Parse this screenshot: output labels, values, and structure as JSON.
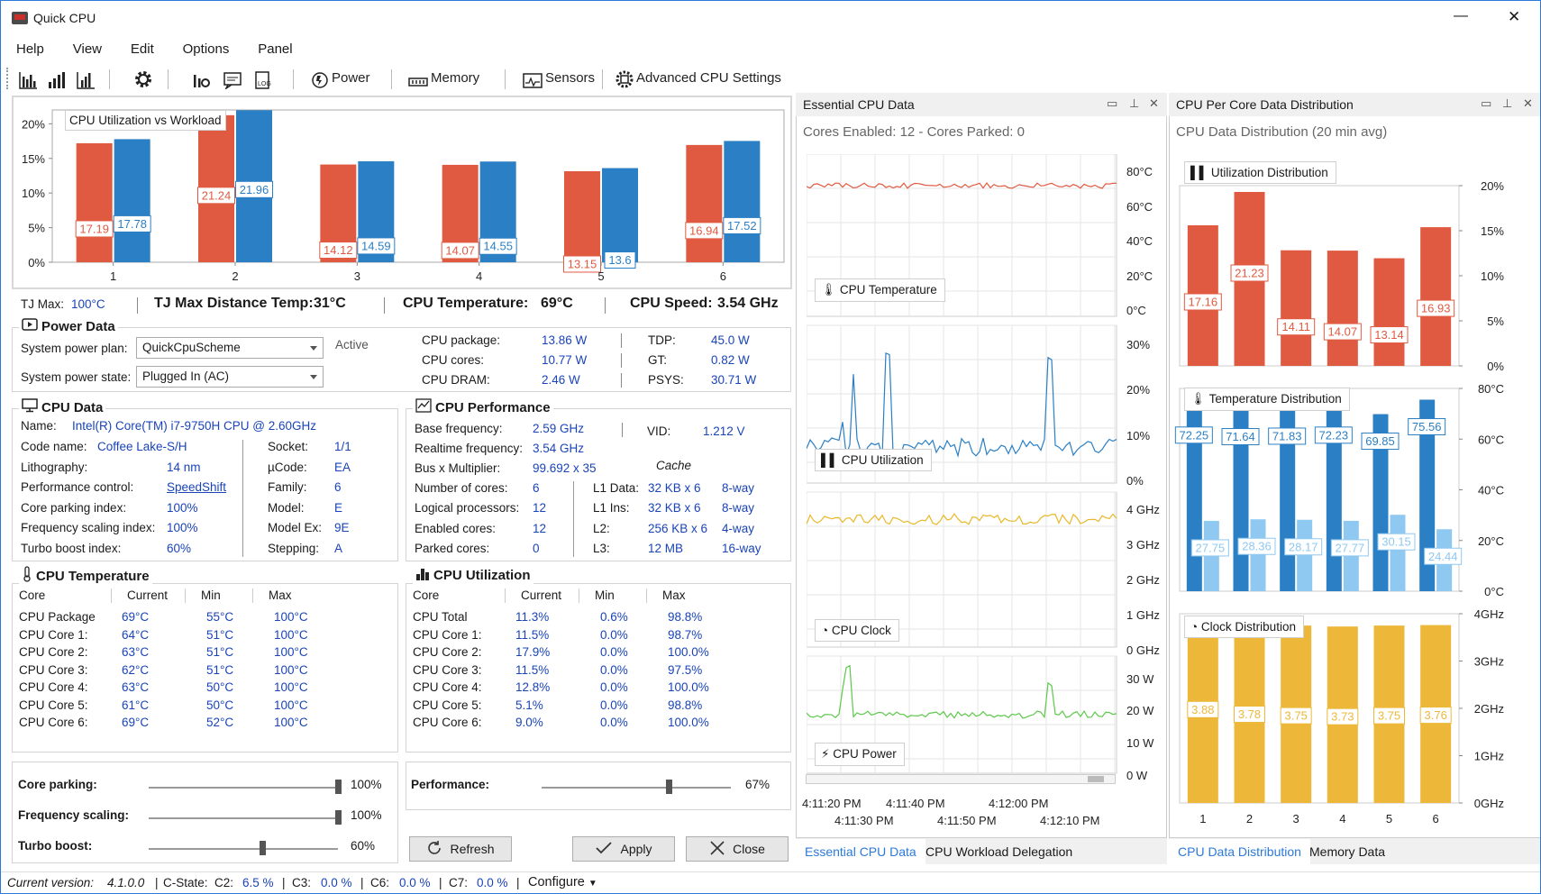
{
  "window": {
    "title": "Quick CPU",
    "minimize": "—",
    "close": "✕"
  },
  "menu": [
    "Help",
    "View",
    "Edit",
    "Options",
    "Panel"
  ],
  "toolbar": {
    "power": "Power",
    "memory": "Memory",
    "sensors": "Sensors",
    "advanced": "Advanced CPU Settings"
  },
  "main_chart": {
    "title": "CPU Utilization vs Workload",
    "chart_data": {
      "type": "bar",
      "categories": [
        "1",
        "2",
        "3",
        "4",
        "5",
        "6"
      ],
      "series": [
        {
          "values": [
            17.19,
            21.24,
            14.12,
            14.07,
            13.15,
            16.94
          ],
          "color": "#e05a41"
        },
        {
          "values": [
            17.78,
            21.96,
            14.59,
            14.55,
            13.6,
            17.52
          ],
          "color": "#2b7fc4"
        }
      ],
      "ylim": [
        0,
        22
      ],
      "yticks": [
        "20%",
        "15%",
        "10%",
        "5%",
        "0%"
      ]
    }
  },
  "tj": {
    "tjmax_label": "TJ Max:",
    "tjmax_value": "100°C",
    "distance_label": "TJ Max Distance Temp:",
    "distance_value": "31°C",
    "temp_label": "CPU Temperature:",
    "temp_value": "69°C",
    "speed_label": "CPU Speed:",
    "speed_value": "3.54 GHz"
  },
  "power": {
    "title": "Power Data",
    "plan_label": "System power plan:",
    "plan_value": "QuickCpuScheme",
    "plan_status": "Active",
    "state_label": "System power state:",
    "state_value": "Plugged In (AC)",
    "pkg_label": "CPU package:",
    "pkg_value": "13.86 W",
    "cores_label": "CPU cores:",
    "cores_value": "10.77 W",
    "dram_label": "CPU DRAM:",
    "dram_value": "2.46 W",
    "tdp_label": "TDP:",
    "tdp_value": "45.0 W",
    "gt_label": "GT:",
    "gt_value": "0.82 W",
    "psys_label": "PSYS:",
    "psys_value": "30.71 W"
  },
  "cpu_data": {
    "title": "CPU Data",
    "name_label": "Name:",
    "name_value": "Intel(R) Core(TM) i7-9750H CPU @ 2.60GHz",
    "codename_label": "Code name:",
    "codename_value": "Coffee Lake-S/H",
    "socket_label": "Socket:",
    "socket_value": "1/1",
    "litho_label": "Lithography:",
    "litho_value": "14 nm",
    "ucode_label": "µCode:",
    "ucode_value": "EA",
    "perf_label": "Performance control:",
    "perf_value": "SpeedShift",
    "family_label": "Family:",
    "family_value": "6",
    "parking_label": "Core parking index:",
    "parking_value": "100%",
    "model_label": "Model:",
    "model_value": "E",
    "freq_label": "Frequency scaling index:",
    "freq_value": "100%",
    "modelex_label": "Model Ex:",
    "modelex_value": "9E",
    "turbo_label": "Turbo boost index:",
    "turbo_value": "60%",
    "stepping_label": "Stepping:",
    "stepping_value": "A"
  },
  "cpu_perf": {
    "title": "CPU Performance",
    "base_label": "Base frequency:",
    "base_value": "2.59 GHz",
    "vid_label": "VID:",
    "vid_value": "1.212 V",
    "real_label": "Realtime frequency:",
    "real_value": "3.54 GHz",
    "bus_label": "Bus x Multiplier:",
    "bus_value": "99.692 x 35",
    "cache_label": "Cache",
    "cores_label": "Number of cores:",
    "cores_value": "6",
    "logical_label": "Logical processors:",
    "logical_value": "12",
    "enabled_label": "Enabled cores:",
    "enabled_value": "12",
    "parked_label": "Parked cores:",
    "parked_value": "0",
    "cache": [
      {
        "label": "L1 Data:",
        "size": "32 KB x 6",
        "way": "8-way"
      },
      {
        "label": "L1 Ins:",
        "size": "32 KB x 6",
        "way": "8-way"
      },
      {
        "label": "L2:",
        "size": "256 KB x 6",
        "way": "4-way"
      },
      {
        "label": "L3:",
        "size": "12 MB",
        "way": "16-way"
      }
    ]
  },
  "cpu_temp": {
    "title": "CPU Temperature",
    "headers": [
      "Core",
      "Current",
      "Min",
      "Max"
    ],
    "rows": [
      [
        "CPU Package",
        "69°C",
        "55°C",
        "100°C"
      ],
      [
        "CPU Core 1:",
        "64°C",
        "51°C",
        "100°C"
      ],
      [
        "CPU Core 2:",
        "63°C",
        "51°C",
        "100°C"
      ],
      [
        "CPU Core 3:",
        "62°C",
        "51°C",
        "100°C"
      ],
      [
        "CPU Core 4:",
        "63°C",
        "50°C",
        "100°C"
      ],
      [
        "CPU Core 5:",
        "61°C",
        "50°C",
        "100°C"
      ],
      [
        "CPU Core 6:",
        "69°C",
        "52°C",
        "100°C"
      ]
    ]
  },
  "cpu_util": {
    "title": "CPU Utilization",
    "headers": [
      "Core",
      "Current",
      "Min",
      "Max"
    ],
    "rows": [
      [
        "CPU Total",
        "11.3%",
        "0.6%",
        "98.8%"
      ],
      [
        "CPU Core 1:",
        "11.5%",
        "0.0%",
        "98.7%"
      ],
      [
        "CPU Core 2:",
        "17.9%",
        "0.0%",
        "100.0%"
      ],
      [
        "CPU Core 3:",
        "11.5%",
        "0.0%",
        "97.5%"
      ],
      [
        "CPU Core 4:",
        "12.8%",
        "0.0%",
        "100.0%"
      ],
      [
        "CPU Core 5:",
        "5.1%",
        "0.0%",
        "98.8%"
      ],
      [
        "CPU Core 6:",
        "9.0%",
        "0.0%",
        "100.0%"
      ]
    ]
  },
  "sliders": {
    "parking_label": "Core parking:",
    "parking_value": "100%",
    "parking_level": 1.0,
    "freq_label": "Frequency scaling:",
    "freq_value": "100%",
    "freq_level": 1.0,
    "turbo_label": "Turbo boost:",
    "turbo_value": "60%",
    "turbo_level": 0.6,
    "perf_label": "Performance:",
    "perf_value": "67%",
    "perf_level": 0.67
  },
  "buttons": {
    "refresh": "Refresh",
    "apply": "Apply",
    "close": "Close"
  },
  "essential": {
    "title": "Essential CPU Data",
    "subtitle": "Cores Enabled: 12 - Cores Parked: 0",
    "temp_badge": "CPU Temperature",
    "temp_ticks": [
      "80°C",
      "60°C",
      "40°C",
      "20°C",
      "0°C"
    ],
    "util_badge": "CPU Utilization",
    "util_ticks": [
      "30%",
      "20%",
      "10%",
      "0%"
    ],
    "clock_badge": "CPU Clock",
    "clock_ticks": [
      "4 GHz",
      "3 GHz",
      "2 GHz",
      "1 GHz",
      "0 GHz"
    ],
    "power_badge": "CPU Power",
    "power_ticks": [
      "30 W",
      "20 W",
      "10 W",
      "0 W"
    ],
    "time_ticks_top": [
      "4:11:20 PM",
      "4:11:40 PM",
      "4:12:00 PM"
    ],
    "time_ticks_bottom": [
      "4:11:30 PM",
      "4:11:50 PM",
      "4:12:10 PM"
    ],
    "tabs": [
      "Essential CPU Data",
      "CPU Workload Delegation"
    ]
  },
  "percore": {
    "title": "CPU Per Core Data Distribution",
    "subtitle": "CPU Data Distribution (20 min avg)",
    "util_badge": "Utilization Distribution",
    "util_ticks": [
      "20%",
      "15%",
      "10%",
      "5%",
      "0%"
    ],
    "util_values": [
      17.16,
      21.23,
      14.11,
      14.07,
      13.14,
      16.93
    ],
    "temp_badge": "Temperature Distribution",
    "temp_ticks": [
      "80°C",
      "60°C",
      "40°C",
      "20°C",
      "0°C"
    ],
    "temp_max": [
      72.25,
      71.64,
      71.83,
      72.23,
      69.85,
      75.56
    ],
    "temp_min": [
      27.75,
      28.36,
      28.17,
      27.77,
      30.15,
      24.44
    ],
    "clock_badge": "Clock Distribution",
    "clock_ticks": [
      "4GHz",
      "3GHz",
      "2GHz",
      "1GHz",
      "0GHz"
    ],
    "clock_values": [
      3.88,
      3.78,
      3.75,
      3.73,
      3.75,
      3.76
    ],
    "categories": [
      "1",
      "2",
      "3",
      "4",
      "5",
      "6"
    ],
    "tabs": [
      "CPU Data Distribution",
      "Memory Data"
    ]
  },
  "status": {
    "version_label": "Current version:",
    "version_value": "4.1.0.0",
    "cstate_label": "C-State:",
    "c2_label": "C2:",
    "c2_value": "6.5 %",
    "c3_label": "C3:",
    "c3_value": "0.0 %",
    "c6_label": "C6:",
    "c6_value": "0.0 %",
    "c7_label": "C7:",
    "c7_value": "0.0 %",
    "configure": "Configure"
  }
}
